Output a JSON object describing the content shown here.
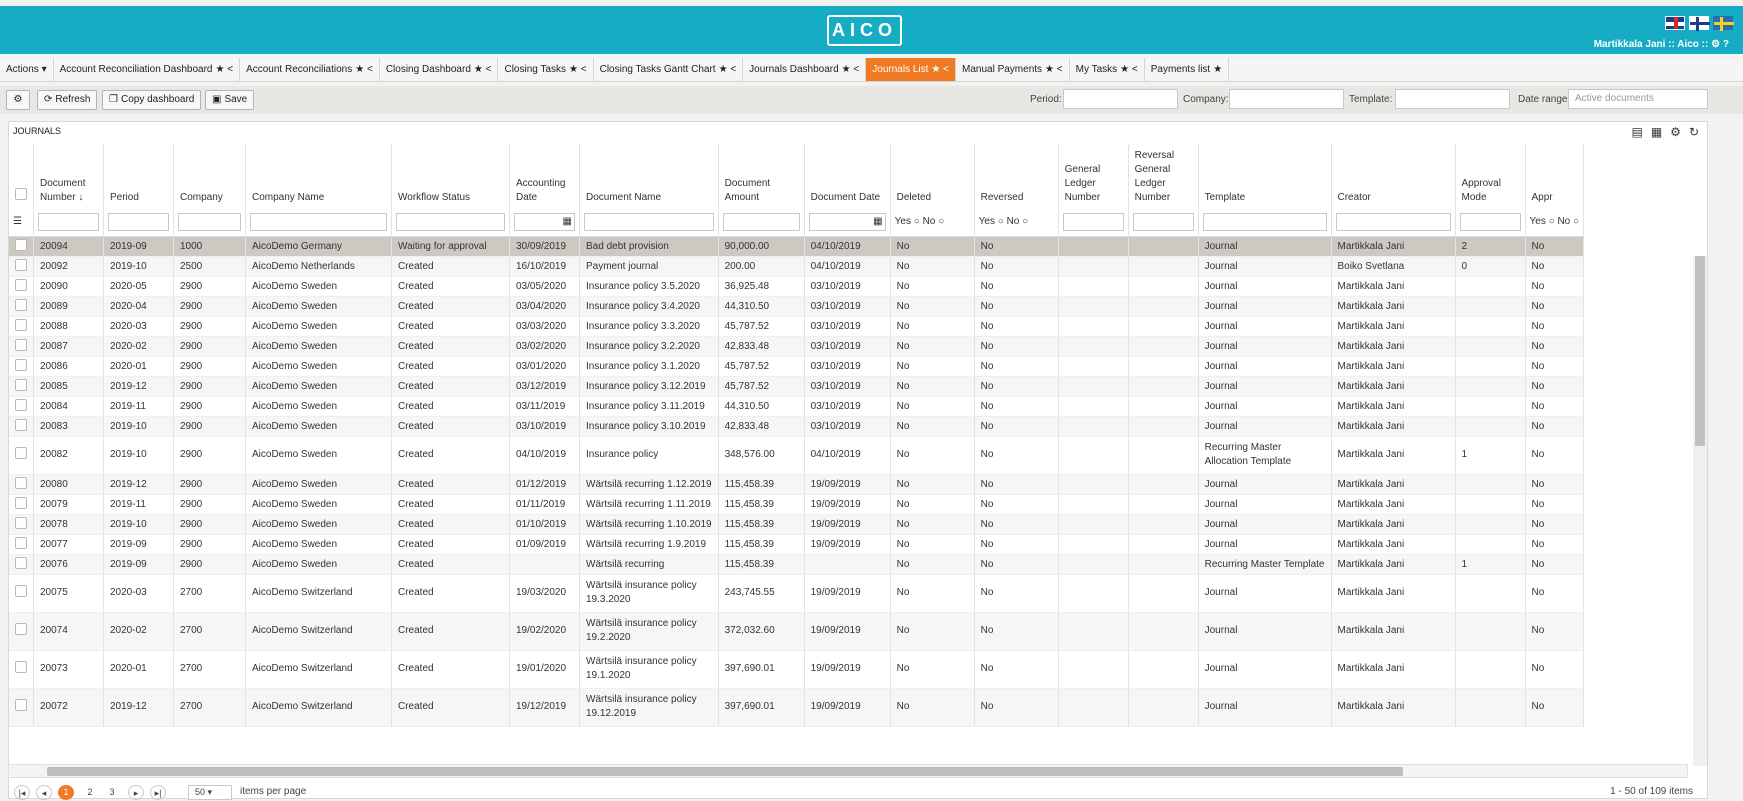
{
  "app": {
    "logo": "AICO",
    "user_line": "Martikkala Jani  ::  Aico  ::"
  },
  "tabs": [
    {
      "label": "Actions ▾",
      "icons": ""
    },
    {
      "label": "Account Reconciliation Dashboard",
      "icons": "★ <"
    },
    {
      "label": "Account Reconciliations",
      "icons": "★ <"
    },
    {
      "label": "Closing Dashboard",
      "icons": "★ <"
    },
    {
      "label": "Closing Tasks",
      "icons": "★ <"
    },
    {
      "label": "Closing Tasks Gantt Chart",
      "icons": "★ <"
    },
    {
      "label": "Journals Dashboard",
      "icons": "★ <"
    },
    {
      "label": "Journals List",
      "icons": "★ <"
    },
    {
      "label": "Manual Payments",
      "icons": "★ <"
    },
    {
      "label": "My Tasks",
      "icons": "★ <"
    },
    {
      "label": "Payments list",
      "icons": "★"
    }
  ],
  "toolbar": {
    "refresh": "Refresh",
    "copy": "Copy dashboard",
    "save": "Save",
    "period_label": "Period:",
    "company_label": "Company:",
    "template_label": "Template:",
    "date_range_label": "Date range",
    "date_range_value": "Active documents"
  },
  "panel": {
    "title": "JOURNALS"
  },
  "columns": [
    "Document Number ↓",
    "Period",
    "Company",
    "Company Name",
    "Workflow Status",
    "Accounting Date",
    "Document Name",
    "Document Amount",
    "Document Date",
    "Deleted",
    "Reversed",
    "General Ledger Number",
    "Reversal General Ledger Number",
    "Template",
    "Creator",
    "Approval Mode",
    "Appr"
  ],
  "filters": {
    "yes": "Yes",
    "no": "No"
  },
  "rows": [
    [
      "20094",
      "2019-09",
      "1000",
      "AicoDemo Germany",
      "Waiting for approval",
      "30/09/2019",
      "Bad debt provision",
      "90,000.00",
      "04/10/2019",
      "No",
      "No",
      "",
      "",
      "Journal",
      "Martikkala Jani",
      "2",
      "No"
    ],
    [
      "20092",
      "2019-10",
      "2500",
      "AicoDemo Netherlands",
      "Created",
      "16/10/2019",
      "Payment journal",
      "200.00",
      "04/10/2019",
      "No",
      "No",
      "",
      "",
      "Journal",
      "Boiko Svetlana",
      "0",
      "No"
    ],
    [
      "20090",
      "2020-05",
      "2900",
      "AicoDemo Sweden",
      "Created",
      "03/05/2020",
      "Insurance policy 3.5.2020",
      "36,925.48",
      "03/10/2019",
      "No",
      "No",
      "",
      "",
      "Journal",
      "Martikkala Jani",
      "",
      "No"
    ],
    [
      "20089",
      "2020-04",
      "2900",
      "AicoDemo Sweden",
      "Created",
      "03/04/2020",
      "Insurance policy 3.4.2020",
      "44,310.50",
      "03/10/2019",
      "No",
      "No",
      "",
      "",
      "Journal",
      "Martikkala Jani",
      "",
      "No"
    ],
    [
      "20088",
      "2020-03",
      "2900",
      "AicoDemo Sweden",
      "Created",
      "03/03/2020",
      "Insurance policy 3.3.2020",
      "45,787.52",
      "03/10/2019",
      "No",
      "No",
      "",
      "",
      "Journal",
      "Martikkala Jani",
      "",
      "No"
    ],
    [
      "20087",
      "2020-02",
      "2900",
      "AicoDemo Sweden",
      "Created",
      "03/02/2020",
      "Insurance policy 3.2.2020",
      "42,833.48",
      "03/10/2019",
      "No",
      "No",
      "",
      "",
      "Journal",
      "Martikkala Jani",
      "",
      "No"
    ],
    [
      "20086",
      "2020-01",
      "2900",
      "AicoDemo Sweden",
      "Created",
      "03/01/2020",
      "Insurance policy 3.1.2020",
      "45,787.52",
      "03/10/2019",
      "No",
      "No",
      "",
      "",
      "Journal",
      "Martikkala Jani",
      "",
      "No"
    ],
    [
      "20085",
      "2019-12",
      "2900",
      "AicoDemo Sweden",
      "Created",
      "03/12/2019",
      "Insurance policy 3.12.2019",
      "45,787.52",
      "03/10/2019",
      "No",
      "No",
      "",
      "",
      "Journal",
      "Martikkala Jani",
      "",
      "No"
    ],
    [
      "20084",
      "2019-11",
      "2900",
      "AicoDemo Sweden",
      "Created",
      "03/11/2019",
      "Insurance policy 3.11.2019",
      "44,310.50",
      "03/10/2019",
      "No",
      "No",
      "",
      "",
      "Journal",
      "Martikkala Jani",
      "",
      "No"
    ],
    [
      "20083",
      "2019-10",
      "2900",
      "AicoDemo Sweden",
      "Created",
      "03/10/2019",
      "Insurance policy 3.10.2019",
      "42,833.48",
      "03/10/2019",
      "No",
      "No",
      "",
      "",
      "Journal",
      "Martikkala Jani",
      "",
      "No"
    ],
    [
      "20082",
      "2019-10",
      "2900",
      "AicoDemo Sweden",
      "Created",
      "04/10/2019",
      "Insurance policy",
      "348,576.00",
      "04/10/2019",
      "No",
      "No",
      "",
      "",
      "Recurring Master Allocation Template",
      "Martikkala Jani",
      "1",
      "No"
    ],
    [
      "20080",
      "2019-12",
      "2900",
      "AicoDemo Sweden",
      "Created",
      "01/12/2019",
      "Wärtsilä recurring 1.12.2019",
      "115,458.39",
      "19/09/2019",
      "No",
      "No",
      "",
      "",
      "Journal",
      "Martikkala Jani",
      "",
      "No"
    ],
    [
      "20079",
      "2019-11",
      "2900",
      "AicoDemo Sweden",
      "Created",
      "01/11/2019",
      "Wärtsilä recurring 1.11.2019",
      "115,458.39",
      "19/09/2019",
      "No",
      "No",
      "",
      "",
      "Journal",
      "Martikkala Jani",
      "",
      "No"
    ],
    [
      "20078",
      "2019-10",
      "2900",
      "AicoDemo Sweden",
      "Created",
      "01/10/2019",
      "Wärtsilä recurring 1.10.2019",
      "115,458.39",
      "19/09/2019",
      "No",
      "No",
      "",
      "",
      "Journal",
      "Martikkala Jani",
      "",
      "No"
    ],
    [
      "20077",
      "2019-09",
      "2900",
      "AicoDemo Sweden",
      "Created",
      "01/09/2019",
      "Wärtsilä recurring 1.9.2019",
      "115,458.39",
      "19/09/2019",
      "No",
      "No",
      "",
      "",
      "Journal",
      "Martikkala Jani",
      "",
      "No"
    ],
    [
      "20076",
      "2019-09",
      "2900",
      "AicoDemo Sweden",
      "Created",
      "",
      "Wärtsilä recurring",
      "115,458.39",
      "",
      "No",
      "No",
      "",
      "",
      "Recurring Master Template",
      "Martikkala Jani",
      "1",
      "No"
    ],
    [
      "20075",
      "2020-03",
      "2700",
      "AicoDemo Switzerland",
      "Created",
      "19/03/2020",
      "Wärtsilä insurance policy 19.3.2020",
      "243,745.55",
      "19/09/2019",
      "No",
      "No",
      "",
      "",
      "Journal",
      "Martikkala Jani",
      "",
      "No"
    ],
    [
      "20074",
      "2020-02",
      "2700",
      "AicoDemo Switzerland",
      "Created",
      "19/02/2020",
      "Wärtsilä insurance policy 19.2.2020",
      "372,032.60",
      "19/09/2019",
      "No",
      "No",
      "",
      "",
      "Journal",
      "Martikkala Jani",
      "",
      "No"
    ],
    [
      "20073",
      "2020-01",
      "2700",
      "AicoDemo Switzerland",
      "Created",
      "19/01/2020",
      "Wärtsilä insurance policy 19.1.2020",
      "397,690.01",
      "19/09/2019",
      "No",
      "No",
      "",
      "",
      "Journal",
      "Martikkala Jani",
      "",
      "No"
    ],
    [
      "20072",
      "2019-12",
      "2700",
      "AicoDemo Switzerland",
      "Created",
      "19/12/2019",
      "Wärtsilä insurance policy 19.12.2019",
      "397,690.01",
      "19/09/2019",
      "No",
      "No",
      "",
      "",
      "Journal",
      "Martikkala Jani",
      "",
      "No"
    ]
  ],
  "pager": {
    "pages": [
      "1",
      "2",
      "3"
    ],
    "page_size": "50",
    "items_per_page": "items per page",
    "summary": "1 - 50 of 109 items"
  },
  "colors": {
    "header": "#16adc4",
    "active_tab": "#f07a24",
    "selected_row": "#cdc8c2"
  }
}
